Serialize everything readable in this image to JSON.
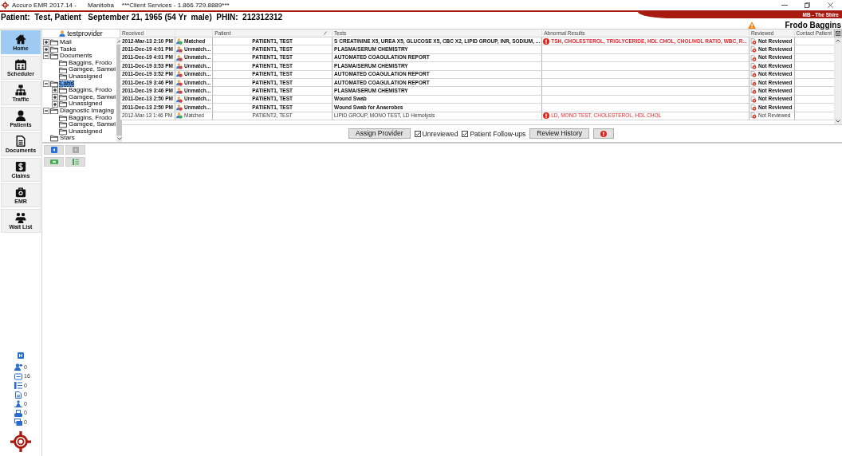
{
  "window": {
    "title": "Accuro EMR 2017.14 -",
    "region": "Manitoba",
    "support": "***Client Services - 1.866.729.8889***"
  },
  "location": "MB - The Shire",
  "patient_header": "Patient:  Test, Patient   September 21, 1965 (54 Yr  male)  PHIN:  212312312",
  "provider": {
    "name": "Frodo Baggins",
    "warning": true
  },
  "sidebar": {
    "items": [
      {
        "label": "Home",
        "selected": true
      },
      {
        "label": "Scheduler",
        "selected": false
      },
      {
        "label": "Traffic",
        "selected": false
      },
      {
        "label": "Patients",
        "selected": false
      },
      {
        "label": "Documents",
        "selected": false
      },
      {
        "label": "Claims",
        "selected": false
      },
      {
        "label": "EMR",
        "selected": false
      },
      {
        "label": "Wait List",
        "selected": false
      }
    ],
    "counters": [
      {
        "count": "0"
      },
      {
        "count": "16"
      },
      {
        "count": "0"
      },
      {
        "count": "0"
      },
      {
        "count": "0"
      },
      {
        "count": "0"
      },
      {
        "count": "0"
      }
    ]
  },
  "tree": {
    "user": "testprovider",
    "items": [
      {
        "label": "Mail",
        "expanded": false,
        "selected": false
      },
      {
        "label": "Tasks",
        "expanded": false,
        "selected": false
      },
      {
        "label": "Documents",
        "expanded": true,
        "selected": false,
        "children": [
          {
            "label": "Baggins, Frodo",
            "selected": false
          },
          {
            "label": "Gamgee, Samwi",
            "selected": false
          },
          {
            "label": "Unassigned",
            "selected": false
          }
        ]
      },
      {
        "label": "Labs",
        "expanded": true,
        "selected": true,
        "children": [
          {
            "label": "Baggins, Frodo",
            "expanded": false,
            "selected": false
          },
          {
            "label": "Gamgee, Samwi",
            "expanded": false,
            "selected": false
          },
          {
            "label": "Unassigned",
            "expanded": false,
            "selected": false
          }
        ]
      },
      {
        "label": "Diagnostic Imaging",
        "expanded": true,
        "selected": false,
        "children": [
          {
            "label": "Baggins, Frodo",
            "selected": false
          },
          {
            "label": "Gamgee, Samwi",
            "selected": false
          },
          {
            "label": "Unassigned",
            "selected": false
          }
        ]
      },
      {
        "label": "Stars",
        "selected": false
      }
    ]
  },
  "table": {
    "columns": [
      {
        "label": "Received",
        "kind": "date",
        "sorted": false
      },
      {
        "kind": "status",
        "sorted": false
      },
      {
        "label": "Patient",
        "kind": "patient",
        "sorted": true
      },
      {
        "label": "Tests",
        "kind": "tests",
        "sorted": false
      },
      {
        "label": "Abnormal Results",
        "kind": "abnormal",
        "sorted": false
      },
      {
        "label": "Reviewed",
        "kind": "review",
        "sorted": false
      },
      {
        "label": "Contact Patient",
        "kind": "contact",
        "sorted": false
      }
    ],
    "rows": [
      {
        "received": "2012-Mar-13 2:10 PM",
        "status": "Matched",
        "matched": true,
        "patient": "PATIENT1, TEST",
        "tests": "S CREATININE X5, UREA X5, GLUCOSE X5, CBC X2, LIPID GROUP, INR, SODIUM, ...",
        "abnormal": "TSH, CHOLESTEROL, TRIGLYCERIDE, HDL CHOL, CHOL/HDL RATIO, WBC, R...",
        "reviewed": "Not Reviewed",
        "unread": true
      },
      {
        "received": "2011-Dec-19 4:01 PM",
        "status": "Unmatch...",
        "matched": false,
        "patient": "PATIENT1, TEST",
        "tests": "PLASMA/SERUM CHEMISTRY",
        "reviewed": "Not Reviewed",
        "unread": true
      },
      {
        "received": "2011-Dec-19 4:01 PM",
        "status": "Unmatch...",
        "matched": false,
        "patient": "PATIENT1, TEST",
        "tests": "AUTOMATED COAGULATION REPORT",
        "reviewed": "Not Reviewed",
        "unread": true
      },
      {
        "received": "2011-Dec-19 3:53 PM",
        "status": "Unmatch...",
        "matched": false,
        "patient": "PATIENT1, TEST",
        "tests": "PLASMA/SERUM CHEMISTRY",
        "reviewed": "Not Reviewed",
        "unread": true
      },
      {
        "received": "2011-Dec-19 3:52 PM",
        "status": "Unmatch...",
        "matched": false,
        "patient": "PATIENT1, TEST",
        "tests": "AUTOMATED COAGULATION REPORT",
        "reviewed": "Not Reviewed",
        "unread": true
      },
      {
        "received": "2011-Dec-19 3:46 PM",
        "status": "Unmatch...",
        "matched": false,
        "patient": "PATIENT1, TEST",
        "tests": "AUTOMATED COAGULATION REPORT",
        "reviewed": "Not Reviewed",
        "unread": true
      },
      {
        "received": "2011-Dec-19 3:46 PM",
        "status": "Unmatch...",
        "matched": false,
        "patient": "PATIENT1, TEST",
        "tests": "PLASMA/SERUM CHEMISTRY",
        "reviewed": "Not Reviewed",
        "unread": true
      },
      {
        "received": "2011-Dec-13 2:50 PM",
        "status": "Unmatch...",
        "matched": false,
        "patient": "PATIENT1, TEST",
        "tests": "Wound Swab",
        "reviewed": "Not Reviewed",
        "unread": true
      },
      {
        "received": "2011-Dec-13 2:50 PM",
        "status": "Unmatch...",
        "matched": false,
        "patient": "PATIENT1, TEST",
        "tests": "Wound Swab for Anaerobes",
        "reviewed": "Not Reviewed",
        "unread": true
      },
      {
        "received": "2012-Mar-13 1:46 PM",
        "status": "Matched",
        "matched": true,
        "patient": "PATIENT2, TEST",
        "tests": "LIPID GROUP, MONO TEST, LD Hemolysis",
        "abnormal": "LD, MONO TEST, CHOLESTEROL, HDL CHOL",
        "reviewed": "Not Reviewed",
        "unread": false
      }
    ]
  },
  "toolbar": [
    {
      "kind": "button",
      "label": "Assign Provider"
    },
    {
      "kind": "checkbox",
      "label": "Unreviewed",
      "checked": true
    },
    {
      "kind": "checkbox",
      "label": "Patient Follow-ups",
      "checked": true
    },
    {
      "kind": "button",
      "label": "Review History"
    },
    {
      "kind": "alert"
    }
  ],
  "history_nav": [
    {
      "disabled": false
    },
    {
      "disabled": true
    }
  ]
}
